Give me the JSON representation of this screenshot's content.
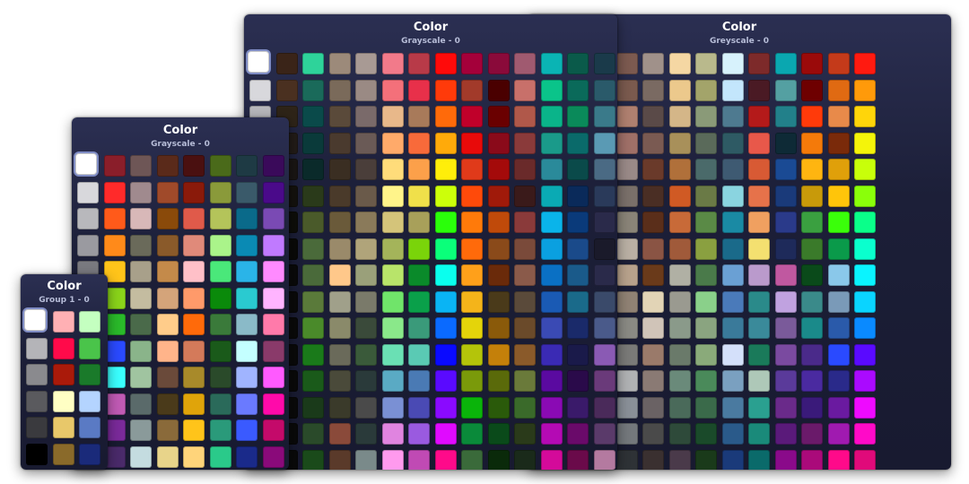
{
  "panels": [
    {
      "id": "back-right",
      "title": "Color",
      "subtitle": "Greyscale - 0",
      "rows": [
        [
          "#255f8d",
          "#0b6cbf",
          "#8a3d2c",
          "#7c5a50",
          "#a0918a",
          "#f5d7a3",
          "#b9b98c",
          "#d7f2fc",
          "#7d2a2a",
          "#0aa7b0",
          "#9a0a0a",
          "#c43a1a",
          "#ff1a10"
        ],
        [
          "#3a4c6b",
          "#38467a",
          "#d07848",
          "#7a5a4e",
          "#7a6a62",
          "#ecc98c",
          "#a3a46a",
          "#c3e6fc",
          "#4a1a24",
          "#54a0a2",
          "#6e0000",
          "#e06a12",
          "#ff9a0a"
        ],
        [
          "#4a5a7a",
          "#c8c8ce",
          "#e8a07a",
          "#b08070",
          "#5a4a48",
          "#d4b688",
          "#8a9a78",
          "#4e7a90",
          "#b41a1a",
          "#22808a",
          "#ff3a0a",
          "#e88a4a",
          "#ffd50a"
        ],
        [
          "#3a4a60",
          "#b4b4ba",
          "#b87a5a",
          "#a07068",
          "#7a5a52",
          "#a8905a",
          "#5a6a5a",
          "#2e5a64",
          "#e8584a",
          "#0e2a36",
          "#f47a0a",
          "#7a2a0a",
          "#f4f40a"
        ],
        [
          "#2e3c58",
          "#868698",
          "#7a6054",
          "#9a8a88",
          "#6a3a2a",
          "#b0703a",
          "#4a6a6a",
          "#3e5a72",
          "#d85a34",
          "#1a4a94",
          "#ffb510",
          "#e0a00a",
          "#c8ff0a"
        ],
        [
          "#2a3854",
          "#6a6a78",
          "#9a7a5a",
          "#7a706a",
          "#4a2e24",
          "#d05a24",
          "#6a7a46",
          "#8ad4e0",
          "#e6724a",
          "#1a3a7a",
          "#c89a0a",
          "#ffc50a",
          "#8aff0a"
        ],
        [
          "#2a3550",
          "#5a5a68",
          "#a89484",
          "#8a8478",
          "#5a2e1a",
          "#c86a38",
          "#5a8a46",
          "#1a8aa4",
          "#f0a060",
          "#2a3a8a",
          "#3aa040",
          "#3aff0a",
          "#0aff8a"
        ],
        [
          "#283248",
          "#4a5060",
          "#e0d4c0",
          "#bab0a4",
          "#8a5444",
          "#a05a3a",
          "#8aa040",
          "#1a6a8a",
          "#f4e070",
          "#1e2a5a",
          "#3a7a2a",
          "#0a9a4a",
          "#0affce"
        ],
        [
          "#252e44",
          "#3c4050",
          "#8a7a6a",
          "#b8a28c",
          "#6a3a1a",
          "#b0b0a4",
          "#4a7a4a",
          "#6aa0d4",
          "#ba9acc",
          "#c058a0",
          "#0a4a1a",
          "#8ac8ea",
          "#0af4ff"
        ],
        [
          "#232b40",
          "#35384a",
          "#a89a8e",
          "#908274",
          "#e2d4b6",
          "#9a9a90",
          "#8ad08a",
          "#4a7aba",
          "#2a8a8a",
          "#c0a2e0",
          "#3a8a8a",
          "#7a9ab8",
          "#0ad4ff"
        ],
        [
          "#21293c",
          "#e0e0e4",
          "#aaa2a0",
          "#8a8a84",
          "#d0c4b8",
          "#8a9a8a",
          "#8aa480",
          "#3a7a9a",
          "#3a8a9a",
          "#7a5a9a",
          "#1a8a8a",
          "#2a5aaa",
          "#0a8aff"
        ],
        [
          "#1f2638",
          "#aeb2b8",
          "#8a8282",
          "#7a7a78",
          "#9a7a6a",
          "#6a7a6a",
          "#8aaa7a",
          "#d4e0fa",
          "#1a7a5a",
          "#7a4aa0",
          "#4a2a8a",
          "#2a4aff",
          "#5a0aff"
        ],
        [
          "#1d2434",
          "#7e8288",
          "#c8ccd0",
          "#b0b2b4",
          "#8a7a74",
          "#6a8a7a",
          "#4a8a5a",
          "#7aa0c0",
          "#aec8b8",
          "#5a3a9a",
          "#4a2aa0",
          "#2a2a8a",
          "#aa0aff"
        ],
        [
          "#1b2230",
          "#5e6268",
          "#787c80",
          "#8a9098",
          "#6a6264",
          "#4a6a5a",
          "#3a6a4a",
          "#4a7aa0",
          "#2aa090",
          "#6a2a8a",
          "#3a1a7a",
          "#6a1aa0",
          "#ee0aff"
        ],
        [
          "#19202c",
          "#40444a",
          "#6a6e72",
          "#74787c",
          "#4a4a4a",
          "#2e4a3a",
          "#1a4a2a",
          "#2a5a8a",
          "#1a8a7a",
          "#5a1a7a",
          "#6a1a6a",
          "#a01ab0",
          "#ff0ac8"
        ],
        [
          "#171e28",
          "#2a2e34",
          "#35393e",
          "#2e3236",
          "#3a3030",
          "#4a3a4a",
          "#1a3a1a",
          "#1a3a7a",
          "#0a6a6a",
          "#8a0a8a",
          "#aa0a7a",
          "#ff0a8a",
          "#e00a7a"
        ]
      ]
    },
    {
      "id": "back-left",
      "title": "Color",
      "subtitle": "Grayscale - 0",
      "rows": [
        [
          "#ffffff",
          "#3a2418",
          "#2ed39a",
          "#9c8a7a",
          "#a89a94",
          "#f27a8a",
          "#b83a48",
          "#ff0a0a",
          "#a4003a",
          "#8a0a3a",
          "#a05a70",
          "#0ab4b4",
          "#0a5a4a",
          "#1a3a4a"
        ],
        [
          "#d8d8dc",
          "#4a3020",
          "#1a6a5a",
          "#7a6a5a",
          "#9a8a84",
          "#f4707a",
          "#e8304a",
          "#ff3a0a",
          "#a23a2a",
          "#4a0000",
          "#c8706a",
          "#0ac48a",
          "#0a6a5a",
          "#2a5a6a"
        ],
        [
          "#b8b8bc",
          "#2e2418",
          "#0a4a4a",
          "#5a4a3a",
          "#7a6a6a",
          "#e8b88a",
          "#a87a5a",
          "#ff6a0a",
          "#c0002a",
          "#6a0000",
          "#b0584a",
          "#0ab48a",
          "#0a8a5a",
          "#3a7a8a"
        ],
        [
          "#9a9aa0",
          "#221c18",
          "#0a3a3a",
          "#4a3a2e",
          "#6a5a56",
          "#ffaa6a",
          "#f86a3a",
          "#ffaa0a",
          "#e80a0a",
          "#8a0a1a",
          "#8a3a3a",
          "#1a9a8a",
          "#0a6a6a",
          "#5a9ab4"
        ],
        [
          "#7a7a80",
          "#1a1614",
          "#0a2a2a",
          "#3a2e22",
          "#4a3e3a",
          "#ffdc7a",
          "#fca04a",
          "#ffee0a",
          "#e03a1a",
          "#a40a0a",
          "#6a2a2a",
          "#2a8a9a",
          "#0a4a4a",
          "#4a6a84"
        ],
        [
          "#6a6a70",
          "#14120e",
          "#2a3a1a",
          "#4a3a2a",
          "#6a5a4a",
          "#fff48a",
          "#f0e04a",
          "#ccff0a",
          "#ff4a0a",
          "#a01a0a",
          "#3a1a1a",
          "#0aaab4",
          "#0a2a5a",
          "#2a3a5a"
        ],
        [
          "#5a5a60",
          "#0e0e0a",
          "#4a5a2a",
          "#6a5a3a",
          "#8a7a5a",
          "#d4c47a",
          "#a8a05a",
          "#2aff0a",
          "#ff7a0a",
          "#c04a0a",
          "#8a3a3a",
          "#0ab4ea",
          "#0a3a7a",
          "#2a2a4a"
        ],
        [
          "#4a4a50",
          "#0a0a08",
          "#4a6a3a",
          "#9a8a6a",
          "#b0a47a",
          "#a4b45a",
          "#7ad40a",
          "#0aff7a",
          "#ff6a0a",
          "#8a4a1a",
          "#7a4a3a",
          "#0aa0e0",
          "#1a4a8a",
          "#1a1a2a"
        ],
        [
          "#3a3a40",
          "#0a0a0a",
          "#4a6a3a",
          "#ffc88a",
          "#9aa07a",
          "#b8e46a",
          "#0a8a2a",
          "#0affee",
          "#ffa01a",
          "#6a2a0a",
          "#8a5a4a",
          "#0a70c4",
          "#1a5a8a",
          "#2a2a4a"
        ],
        [
          "#2a2a30",
          "#0a0a0a",
          "#5a7a3a",
          "#a0a08a",
          "#7a7a6a",
          "#70e46a",
          "#0aa04a",
          "#0ab4f4",
          "#f4b41a",
          "#4a3a1a",
          "#5a4a3a",
          "#1a5ab4",
          "#1a6a8a",
          "#3a4a6a"
        ],
        [
          "#1e1e24",
          "#0a0a0a",
          "#4a8a2a",
          "#8a8a6a",
          "#3a4a3a",
          "#8ae88a",
          "#3a9a7a",
          "#0a6aff",
          "#e4d40a",
          "#8a5a0a",
          "#6a4a2a",
          "#3a4ab4",
          "#1a2a6a",
          "#4a5a8a"
        ],
        [
          "#121218",
          "#0a0a0a",
          "#1a7a1a",
          "#6a6a5a",
          "#3a5a3a",
          "#6ae0b4",
          "#5acab4",
          "#0a0aff",
          "#b4c40a",
          "#c4800a",
          "#8a5a2a",
          "#3a2ab4",
          "#1a1a4a",
          "#8a5ab4"
        ],
        [
          "#0a0a10",
          "#0a0a0a",
          "#1a5a1a",
          "#4a4a3a",
          "#2a3a3a",
          "#5aaac4",
          "#4a7ab4",
          "#5a0aff",
          "#7a9a0a",
          "#5a6a0a",
          "#6a7a3a",
          "#5a0aa0",
          "#2a0a4a",
          "#6a3a7a"
        ],
        [
          "#0a0a0a",
          "#0a0a0a",
          "#1a3a1a",
          "#3a3a2a",
          "#4a4a4a",
          "#7a90d4",
          "#4a4ab4",
          "#8a0aff",
          "#0ab40a",
          "#2a5a0a",
          "#3a6a2a",
          "#8a0ab4",
          "#3a1a6a",
          "#4a2a5a"
        ],
        [
          "#0a0a0a",
          "#0a0a0a",
          "#2a4a2a",
          "#8a4a3a",
          "#2a3a3a",
          "#e084e0",
          "#9a5ae0",
          "#e00aff",
          "#0a8a3a",
          "#0a4a1a",
          "#2a3a1a",
          "#b40ab4",
          "#6a0a6a",
          "#5a3a6a"
        ],
        [
          "#0a0a0a",
          "#0a0a0a",
          "#1a4a1a",
          "#5a3a2a",
          "#7a8a8a",
          "#ff9aee",
          "#c04ab4",
          "#ff0a8a",
          "#3a6a3a",
          "#0a2a0a",
          "#1a2a1a",
          "#d40a9a",
          "#6a0a4a",
          "#b47aa0"
        ]
      ]
    },
    {
      "id": "middle",
      "title": "Color",
      "subtitle": "Grayscale - 0",
      "rows": [
        [
          "#ffffff",
          "#8a1e2a",
          "#6e5656",
          "#5a2a1a",
          "#4a1010",
          "#4a6a1a",
          "#1e3a44",
          "#3a0a5a"
        ],
        [
          "#d8d8dc",
          "#ff2a2a",
          "#a08a8e",
          "#a04a2a",
          "#8a1a0a",
          "#8a9a3a",
          "#3a5a6a",
          "#4a0a8a"
        ],
        [
          "#b8b8bc",
          "#ff5a1a",
          "#d8b8b8",
          "#8a4a0a",
          "#e05a4a",
          "#b4c45a",
          "#0a6a8a",
          "#7a4ab4"
        ],
        [
          "#9a9aa0",
          "#ff8a1a",
          "#6a6a5a",
          "#8a5a2a",
          "#e08a7a",
          "#aaf48a",
          "#0a8ab4",
          "#c07aff"
        ],
        [
          "#7a7a80",
          "#ffc41a",
          "#a8a08a",
          "#c48a4a",
          "#ffc0c8",
          "#4ae87a",
          "#2ab4e8",
          "#ff8aff"
        ],
        [
          "#5a5a60",
          "#8ad41a",
          "#c4bca0",
          "#d4a47a",
          "#ff9a6a",
          "#0a8a0a",
          "#2acad0",
          "#ffb4ff"
        ],
        [
          "#3a3a40",
          "#2aba2a",
          "#4a6a4a",
          "#ffcc8a",
          "#ff6a0a",
          "#3a7a3a",
          "#8abac8",
          "#ff7aaa"
        ],
        [
          "#2a2a30",
          "#2a4aff",
          "#8ab48a",
          "#ffb48a",
          "#d47a5a",
          "#1a5a1a",
          "#c4ffff",
          "#8a3a6a"
        ],
        [
          "#1a1a20",
          "#3affff",
          "#a0c4a0",
          "#6a4a3a",
          "#a88a2a",
          "#2a4a2a",
          "#a0b4ff",
          "#ff5aff"
        ],
        [
          "#0e0e14",
          "#c05ab4",
          "#5a6a6a",
          "#4a3a1a",
          "#e0a40a",
          "#2a6a5a",
          "#6a7aff",
          "#ff0aaa"
        ],
        [
          "#0a0a10",
          "#7a2a9a",
          "#8a9a9a",
          "#8a6a3a",
          "#ffc41a",
          "#2a9a7a",
          "#3a5aff",
          "#c40a6a"
        ],
        [
          "#0a0a0a",
          "#4a2a6a",
          "#c4dce0",
          "#e8d48a",
          "#ffd47a",
          "#2aca8a",
          "#1a2a8a",
          "#8a0a7a"
        ]
      ]
    },
    {
      "id": "front-small",
      "title": "Color",
      "subtitle": "Group 1 - 0",
      "rows": [
        [
          "#ffffff",
          "#ffb0b4",
          "#c4ffc0"
        ],
        [
          "#b4b4b8",
          "#ff0a4a",
          "#4ac44a"
        ],
        [
          "#8a8a8e",
          "#aa1a0a",
          "#1a7a2a"
        ],
        [
          "#5a5a5e",
          "#ffffc4",
          "#b4d4ff"
        ],
        [
          "#3a3a3e",
          "#e8c86a",
          "#5a7ac4"
        ],
        [
          "#000000",
          "#8a6a2a",
          "#1a2a7a"
        ]
      ]
    }
  ]
}
